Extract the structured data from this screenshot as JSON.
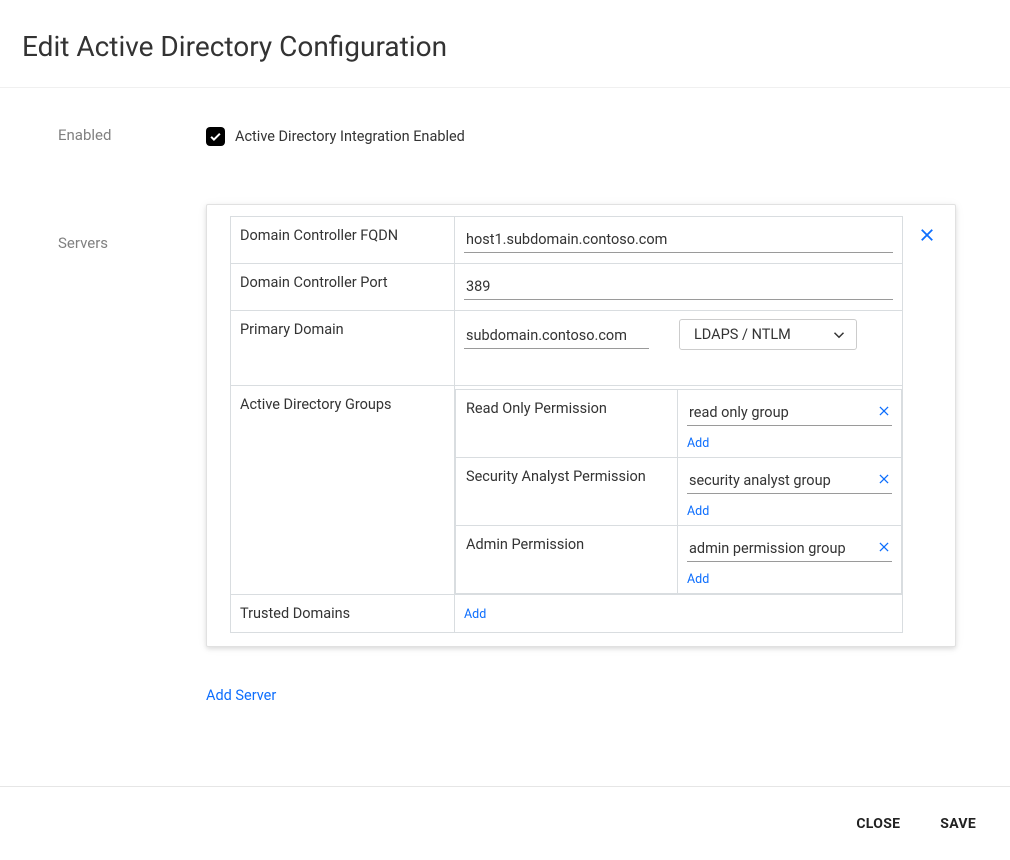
{
  "page": {
    "title": "Edit Active Directory Configuration"
  },
  "form": {
    "enabled_label": "Enabled",
    "enabled_checkbox_label": "Active Directory Integration Enabled",
    "servers_label": "Servers",
    "add_server": "Add Server"
  },
  "server": {
    "fqdn_label": "Domain Controller FQDN",
    "fqdn_value": "host1.subdomain.contoso.com",
    "port_label": "Domain Controller Port",
    "port_value": "389",
    "primary_domain_label": "Primary Domain",
    "primary_domain_value": "subdomain.contoso.com",
    "auth_method": "LDAPS / NTLM",
    "groups_label": "Active Directory Groups",
    "groups": [
      {
        "label": "Read Only Permission",
        "value": "read only group"
      },
      {
        "label": "Security Analyst Permission",
        "value": "security analyst group"
      },
      {
        "label": "Admin Permission",
        "value": "admin permission group"
      }
    ],
    "trusted_domains_label": "Trusted Domains",
    "add_link": "Add"
  },
  "footer": {
    "close": "CLOSE",
    "save": "SAVE"
  }
}
